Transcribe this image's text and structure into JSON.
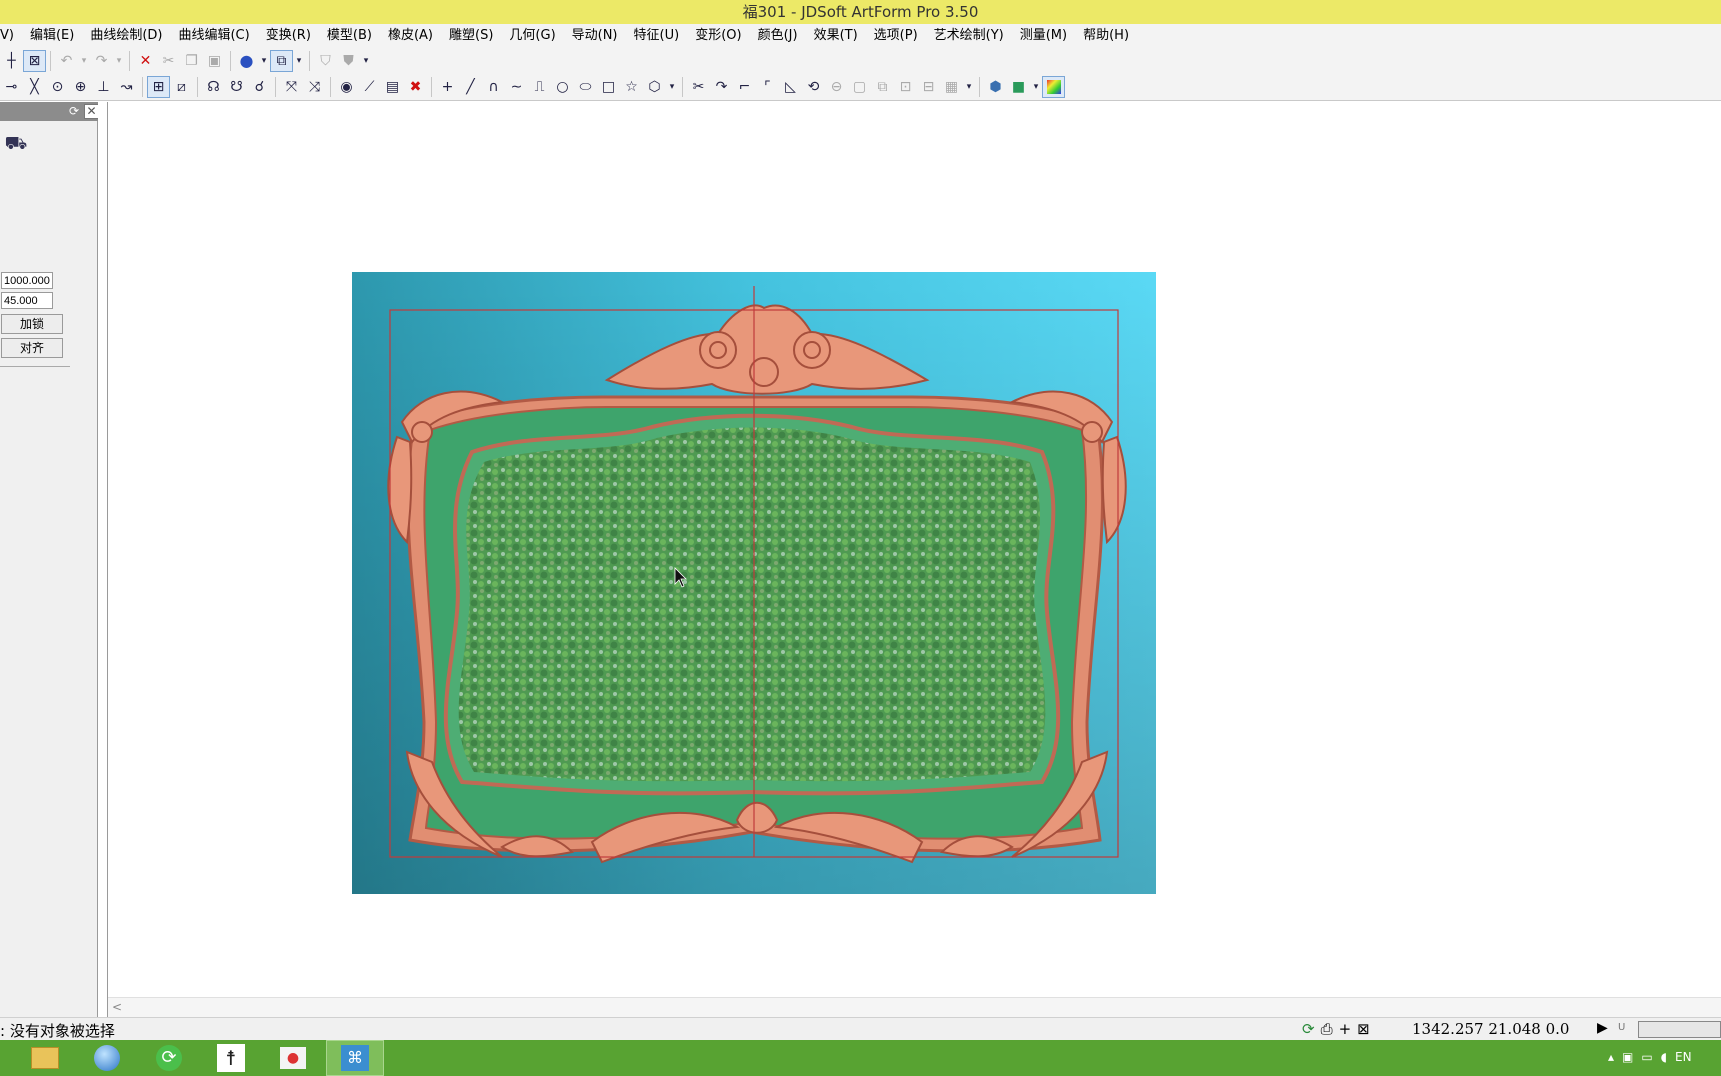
{
  "window": {
    "title": "福301 - JDSoft ArtForm Pro 3.50"
  },
  "menu": [
    "V)",
    "编辑(E)",
    "曲线绘制(D)",
    "曲线编辑(C)",
    "变换(R)",
    "模型(B)",
    "橡皮(A)",
    "雕塑(S)",
    "几何(G)",
    "导动(N)",
    "特征(U)",
    "变形(O)",
    "颜色(J)",
    "效果(T)",
    "选项(P)",
    "艺术绘制(Y)",
    "测量(M)",
    "帮助(H)"
  ],
  "toolbar1_icons": [
    "snap-icon",
    "select-box-icon",
    "undo-icon",
    "redo-icon",
    "delete-icon",
    "cut-icon",
    "copy-icon",
    "paste-icon",
    "sphere-view-icon",
    "cube-view-icon",
    "shade-icon",
    "shade-dark-icon"
  ],
  "toolbar2_icons": [
    "point-icon",
    "cross-icon",
    "circle-snap-icon",
    "target-icon",
    "perpendicular-icon",
    "tangent-icon",
    "grid-icon",
    "zoom-box-icon",
    "node-icon",
    "node-add-icon",
    "node-del-icon",
    "pick-icon",
    "unpick-icon",
    "eye-icon",
    "trim-icon",
    "text-box-icon",
    "close-x-icon",
    "plus-icon",
    "line-icon",
    "arc-icon",
    "wave-icon",
    "polyline-icon",
    "circle-icon",
    "ellipse-icon",
    "rectangle-icon",
    "star-icon",
    "polygon-icon",
    "scissors-icon",
    "curve-icon",
    "fillet-icon",
    "chamfer-icon",
    "corner-icon",
    "offset-icon",
    "link-icon",
    "square-icon",
    "layers-icon",
    "group-icon",
    "ungroup-icon",
    "cube-icon",
    "fill-color-icon",
    "gradient-icon"
  ],
  "panel": {
    "size_value": "1000.000",
    "angle_value": "45.000",
    "lock_label": "加锁",
    "align_label": "对齐"
  },
  "status": {
    "message": ": 没有对象被选择",
    "coords": "1342.257  21.048  0.0",
    "mode": "U"
  },
  "colors": {
    "title_bar": "#ece967",
    "taskbar": "#58a332",
    "relief_background": "#44c3df",
    "relief_green": "#3ea46c",
    "relief_carving": "#e38d73"
  },
  "taskbar_apps": [
    "file-explorer-icon",
    "browser-icon",
    "refresh-app-icon",
    "figure-app-icon",
    "media-app-icon",
    "artform-app-icon"
  ],
  "tray": {
    "lang": "EN"
  }
}
